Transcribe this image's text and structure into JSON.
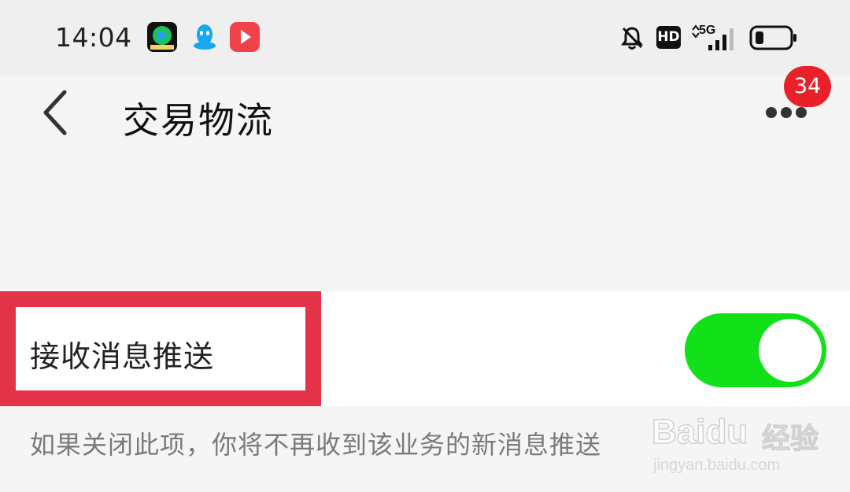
{
  "status_bar": {
    "time": "14:04",
    "apps": [
      "video-app-icon",
      "qq-icon",
      "red-play-icon"
    ],
    "hd_label": "HD",
    "network_label": "5G",
    "icons": [
      "bell-muted-icon",
      "signal-icon",
      "battery-icon"
    ]
  },
  "header": {
    "title": "交易物流",
    "badge_count": "34",
    "back_icon": "chevron-left-icon",
    "more_icon": "more-dots-icon"
  },
  "setting": {
    "label": "接收消息推送",
    "toggle_on": true,
    "hint": "如果关闭此项，你将不再收到该业务的新消息推送"
  },
  "watermark": {
    "brand": "Bai",
    "brand2": "du",
    "cn": "经验",
    "url": "jingyan.baidu.com"
  },
  "colors": {
    "toggle_on": "#12e018",
    "highlight": "#e23349",
    "badge": "#e8202a"
  }
}
